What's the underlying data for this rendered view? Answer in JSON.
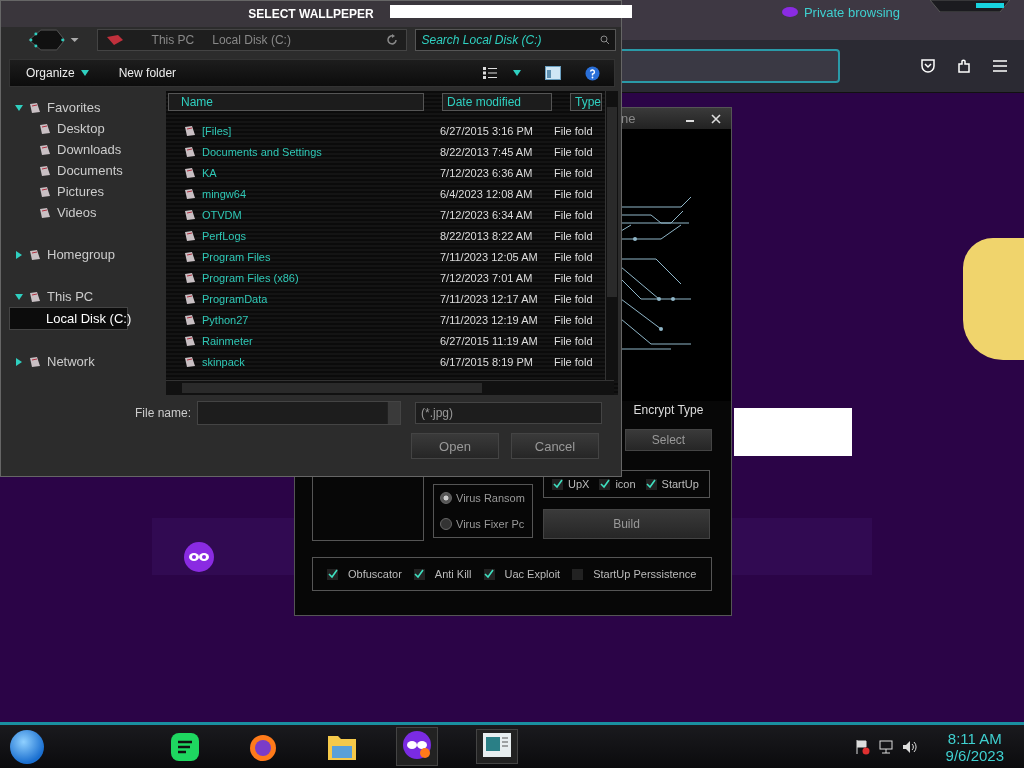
{
  "browser": {
    "tab_title": "Private browsing"
  },
  "builder": {
    "title": "ne",
    "encrypt_label": "Encrypt Type",
    "select_button": "Select",
    "options": [
      {
        "label": "UpX",
        "checked": true
      },
      {
        "label": "icon",
        "checked": true
      },
      {
        "label": "StartUp",
        "checked": true
      }
    ],
    "modes": [
      {
        "label": "Virus Ransom",
        "selected": true
      },
      {
        "label": "Virus Fixer Pc",
        "selected": false
      }
    ],
    "build_button": "Build",
    "features": [
      {
        "label": "Obfuscator",
        "checked": true
      },
      {
        "label": "Anti Kill",
        "checked": true
      },
      {
        "label": "Uac Exploit",
        "checked": true
      },
      {
        "label": "StartUp Perssistence",
        "checked": false
      }
    ]
  },
  "dialog": {
    "title": "SELECT WALLPEPER",
    "breadcrumb": [
      "This PC",
      "Local Disk (C:)"
    ],
    "search": {
      "placeholder": "Search Local Disk (C:)"
    },
    "toolbar": {
      "organize": "Organize",
      "new_folder": "New folder"
    },
    "sidebar": {
      "items": [
        {
          "label": "Favorites",
          "expanded": true,
          "selected": false,
          "children": [
            {
              "label": "Desktop",
              "selected": false
            },
            {
              "label": "Downloads",
              "selected": false
            },
            {
              "label": "Documents",
              "selected": false
            },
            {
              "label": "Pictures",
              "selected": false
            },
            {
              "label": "Videos",
              "selected": false
            }
          ]
        },
        {
          "label": "Homegroup",
          "expanded": false,
          "selected": false
        },
        {
          "label": "This PC",
          "expanded": true,
          "selected": false,
          "children": [
            {
              "label": "Local Disk (C:)",
              "selected": true
            }
          ]
        },
        {
          "label": "Network",
          "expanded": false,
          "selected": false
        }
      ]
    },
    "table": {
      "columns": [
        "Name",
        "Date modified",
        "Type"
      ],
      "rows": [
        {
          "name": "[Files]",
          "date": "6/27/2015 3:16 PM",
          "type": "File fold"
        },
        {
          "name": "Documents and Settings",
          "date": "8/22/2013 7:45 AM",
          "type": "File fold"
        },
        {
          "name": "KA",
          "date": "7/12/2023 6:36 AM",
          "type": "File fold"
        },
        {
          "name": "mingw64",
          "date": "6/4/2023 12:08 AM",
          "type": "File fold"
        },
        {
          "name": "OTVDM",
          "date": "7/12/2023 6:34 AM",
          "type": "File fold"
        },
        {
          "name": "PerfLogs",
          "date": "8/22/2013 8:22 AM",
          "type": "File fold"
        },
        {
          "name": "Program Files",
          "date": "7/11/2023 12:05 AM",
          "type": "File fold"
        },
        {
          "name": "Program Files (x86)",
          "date": "7/12/2023 7:01 AM",
          "type": "File fold"
        },
        {
          "name": "ProgramData",
          "date": "7/11/2023 12:17 AM",
          "type": "File fold"
        },
        {
          "name": "Python27",
          "date": "7/11/2023 12:19 AM",
          "type": "File fold"
        },
        {
          "name": "Rainmeter",
          "date": "6/27/2015 11:19 AM",
          "type": "File fold"
        },
        {
          "name": "skinpack",
          "date": "6/17/2015 8:19 PM",
          "type": "File fold"
        }
      ]
    },
    "file_name": {
      "label": "File name:"
    },
    "filter": "(*.jpg)",
    "buttons": [
      "Open",
      "Cancel"
    ]
  },
  "taskbar": {
    "time": "8:11 AM",
    "date": "9/6/2023"
  }
}
